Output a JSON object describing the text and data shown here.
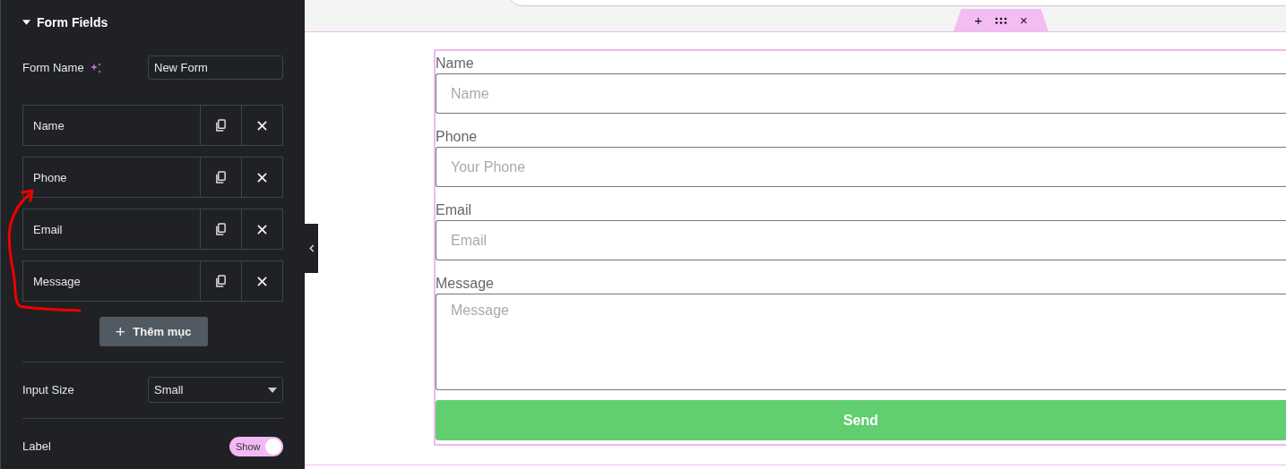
{
  "panel": {
    "section_title": "Form Fields",
    "expanded": true,
    "form_name": {
      "label": "Form Name",
      "value": "New Form"
    },
    "items": [
      {
        "label": "Name"
      },
      {
        "label": "Phone"
      },
      {
        "label": "Email"
      },
      {
        "label": "Message"
      }
    ],
    "add_button": "+",
    "add_label": "Thêm mục",
    "input_size": {
      "label": "Input Size",
      "value": "Small"
    },
    "label_toggle": {
      "label": "Label",
      "on": true,
      "text": "Show"
    }
  },
  "canvas": {
    "toolbar": [
      "+",
      "×"
    ],
    "fields": [
      {
        "kind": "input",
        "label": "Name",
        "placeholder": "Name"
      },
      {
        "kind": "input",
        "label": "Phone",
        "placeholder": "Your Phone"
      },
      {
        "kind": "input",
        "label": "Email",
        "placeholder": "Email"
      },
      {
        "kind": "textarea",
        "label": "Message",
        "placeholder": "Message"
      }
    ],
    "submit": "Send"
  }
}
